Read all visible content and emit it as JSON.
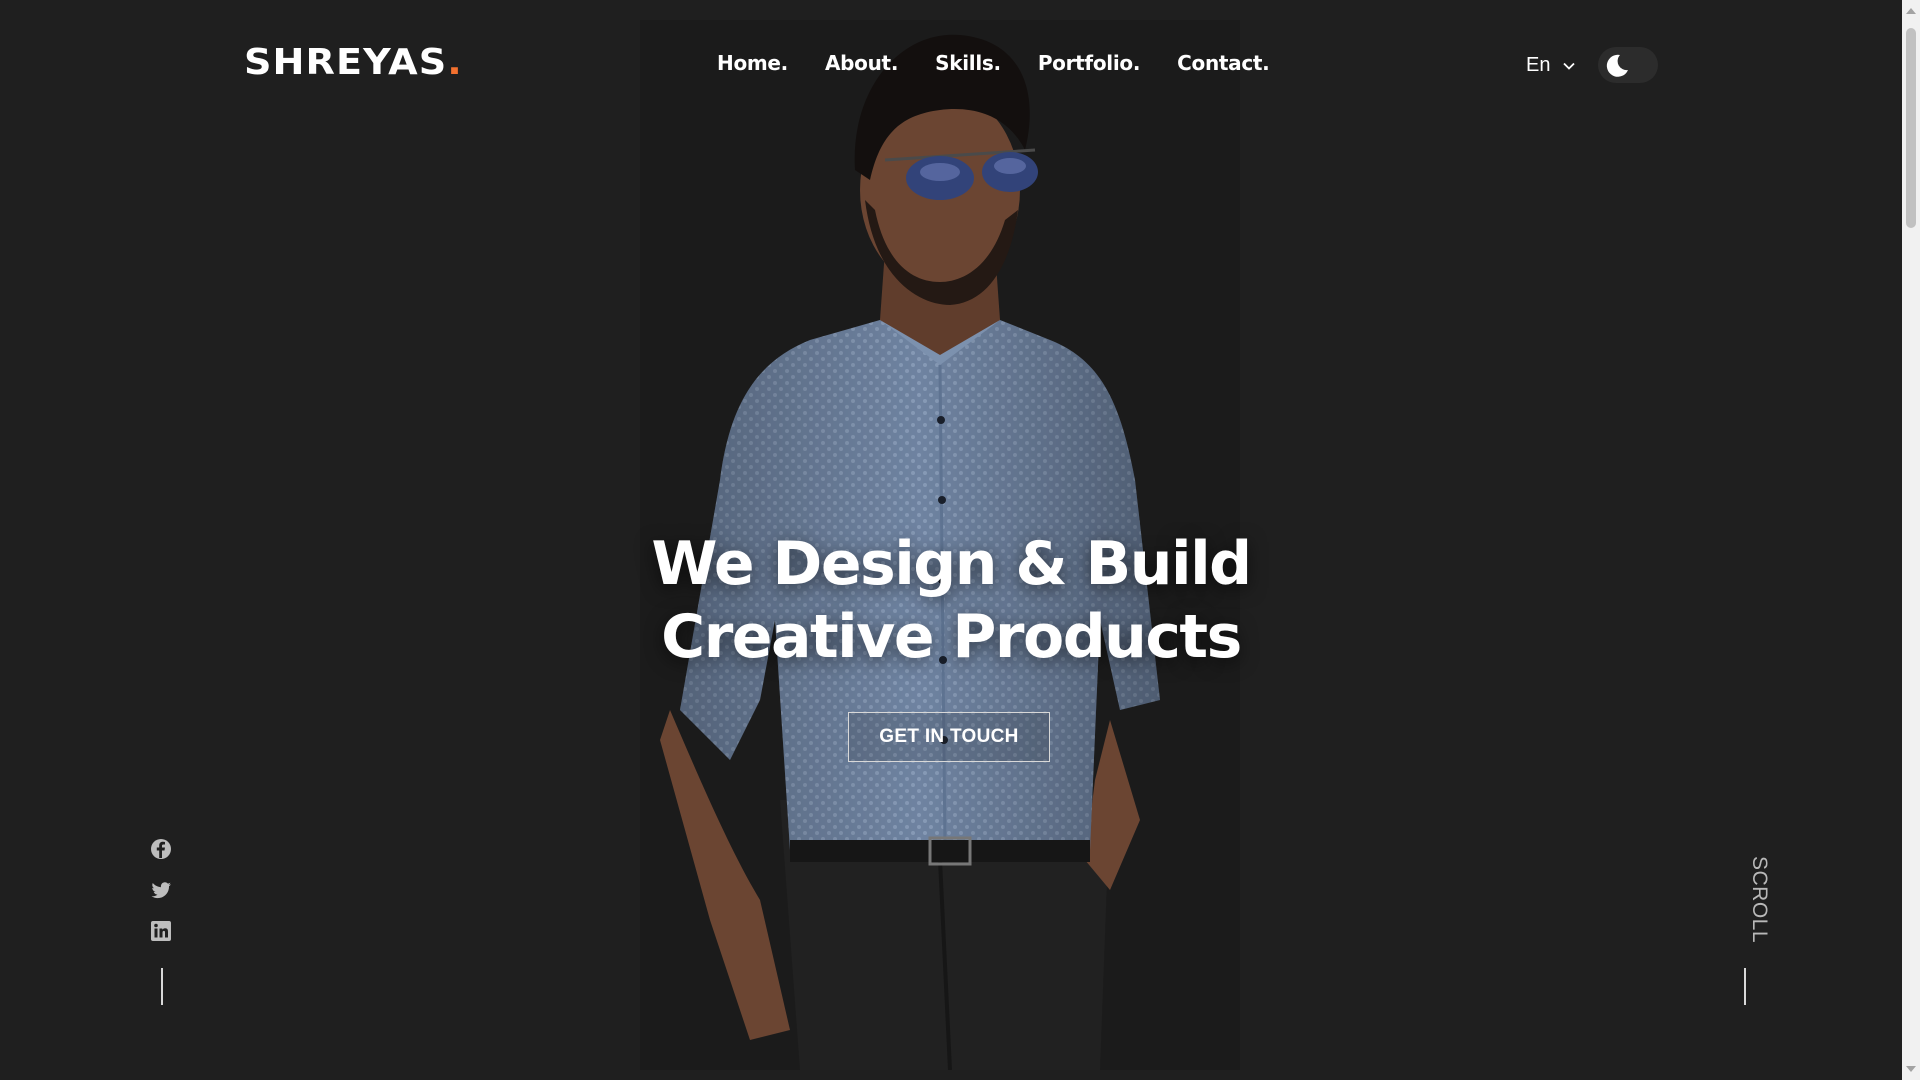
{
  "header": {
    "logo_text": "SHREYAS",
    "logo_dot": ".",
    "nav": [
      "Home.",
      "About.",
      "Skills.",
      "Portfolio.",
      "Contact."
    ],
    "language": "En",
    "theme_icon": "moon-icon"
  },
  "hero": {
    "title_line1": "We Design & Build",
    "title_line2": "Creative Products",
    "cta_label": "GET IN TOUCH"
  },
  "social": [
    "facebook-icon",
    "twitter-icon",
    "linkedin-icon"
  ],
  "scroll_label": "SCROLL",
  "colors": {
    "background": "#1f1f1f",
    "accent": "#f4712f",
    "text": "#ffffff"
  }
}
